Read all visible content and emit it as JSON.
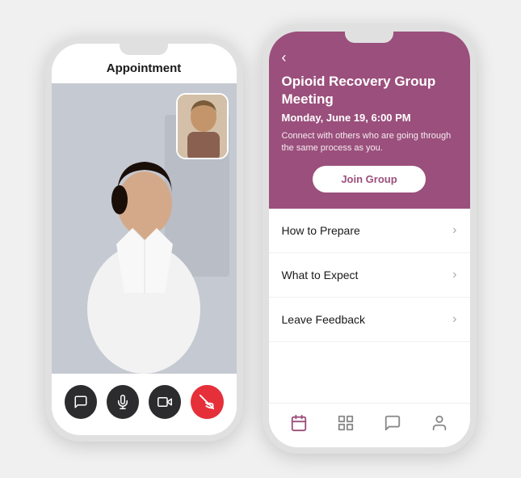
{
  "left_phone": {
    "header": "Appointment",
    "controls": [
      {
        "id": "chat",
        "symbol": "💬",
        "style": "dark"
      },
      {
        "id": "mic",
        "symbol": "🎤",
        "style": "dark"
      },
      {
        "id": "video",
        "symbol": "📹",
        "style": "dark"
      },
      {
        "id": "endcall",
        "symbol": "📵",
        "style": "red"
      }
    ]
  },
  "right_phone": {
    "back_label": "‹",
    "meeting_title": "Opioid Recovery Group Meeting",
    "meeting_datetime": "Monday, June 19, 6:00 PM",
    "meeting_desc": "Connect with others who are going through the same process as you.",
    "join_button": "Join Group",
    "menu_items": [
      {
        "label": "How to Prepare"
      },
      {
        "label": "What to Expect"
      },
      {
        "label": "Leave Feedback"
      }
    ],
    "bottom_nav": [
      {
        "id": "calendar",
        "active": true
      },
      {
        "id": "grid"
      },
      {
        "id": "chat"
      },
      {
        "id": "profile"
      }
    ]
  },
  "colors": {
    "purple": "#9b4f7c",
    "dark": "#2c2c2e",
    "red": "#e5303a"
  }
}
